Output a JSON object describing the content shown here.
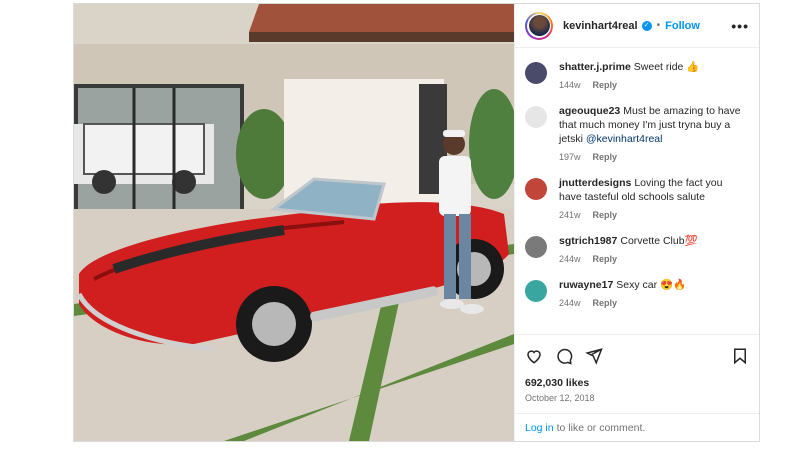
{
  "header": {
    "username": "kevinhart4real",
    "verified_mark": "✓",
    "separator": "•",
    "follow_label": "Follow",
    "more_label": "•••"
  },
  "comments": [
    {
      "username": "shatter.j.prime",
      "text": "Sweet ride 👍",
      "time": "144w",
      "reply": "Reply",
      "avatar_color": "#4a4a6a"
    },
    {
      "username": "ageouque23",
      "text": "Must be amazing to have that much money I'm just tryna buy a jetski ",
      "mention": "@kevinhart4real",
      "time": "197w",
      "reply": "Reply",
      "avatar_color": "#e6e6e6"
    },
    {
      "username": "jnutterdesigns",
      "text": "Loving the fact you have tasteful old schools salute",
      "time": "241w",
      "reply": "Reply",
      "avatar_color": "#c2453a"
    },
    {
      "username": "sgtrich1987",
      "text": "Corvette Club💯",
      "time": "244w",
      "reply": "Reply",
      "avatar_color": "#7a7a7a"
    },
    {
      "username": "ruwayne17",
      "text": "Sexy car 😍🔥",
      "time": "244w",
      "reply": "Reply",
      "avatar_color": "#3aa6a0"
    }
  ],
  "icons": [
    "heart-icon",
    "comment-icon",
    "share-icon",
    "bookmark-icon"
  ],
  "likes": "692,030 likes",
  "date": "October 12, 2018",
  "login": {
    "link": "Log in",
    "text": "to like or comment."
  },
  "colors": {
    "accent": "#0095f6",
    "car": "#d11f1f"
  }
}
